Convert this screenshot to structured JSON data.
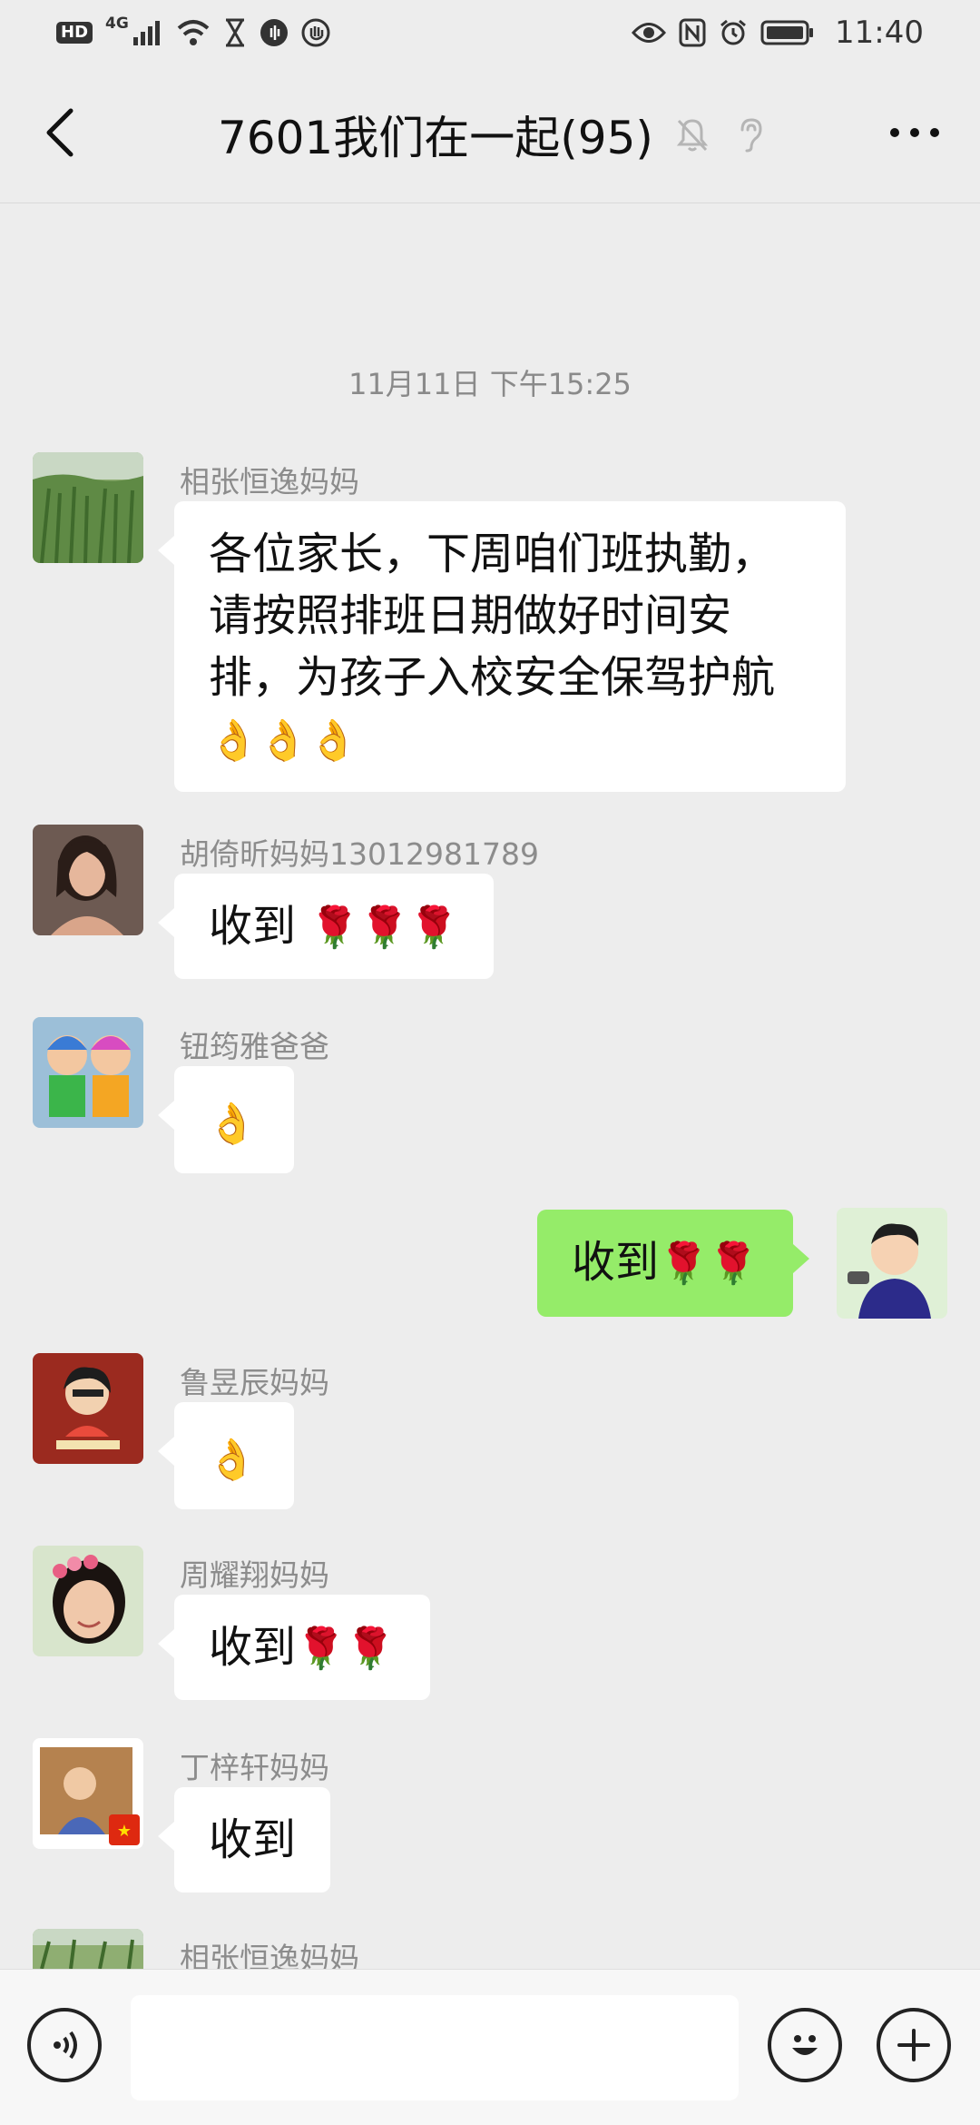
{
  "status_bar": {
    "hd": "HD",
    "network": "4G",
    "time": "11:40",
    "icons": [
      "signal-icon",
      "wifi-icon",
      "hourglass-icon",
      "sound-icon",
      "hand-icon",
      "eye-icon",
      "nfc-icon",
      "alarm-icon",
      "battery-icon"
    ]
  },
  "header": {
    "title": "7601我们在一起(95)",
    "icons": [
      "back-icon",
      "mute-bell-icon",
      "earpiece-icon",
      "more-icon"
    ]
  },
  "chat": {
    "timestamp": "11月11日 下午15:25",
    "messages": [
      {
        "sender": "相张恒逸妈妈",
        "text": "各位家长，下周咱们班执勤，请按照排班日期做好时间安排，为孩子入校安全保驾护航",
        "emoji": "👌👌👌"
      },
      {
        "sender": "胡倚昕妈妈13012981789",
        "text": "收到",
        "emoji": "🌹🌹🌹"
      },
      {
        "sender": "钮筠雅爸爸",
        "text": "",
        "emoji": "👌"
      },
      {
        "sender": "",
        "text": "收到",
        "emoji": "🌹🌹",
        "mine": true
      },
      {
        "sender": "鲁昱辰妈妈",
        "text": "",
        "emoji": "👌"
      },
      {
        "sender": "周耀翔妈妈",
        "text": "收到",
        "emoji": "🌹🌹"
      },
      {
        "sender": "丁梓轩妈妈",
        "text": "收到",
        "emoji": ""
      },
      {
        "sender": "相张恒逸妈妈",
        "text": "",
        "emoji": ""
      }
    ]
  },
  "input_bar": {
    "value": "",
    "icons": [
      "voice-icon",
      "emoji-icon",
      "plus-icon"
    ]
  },
  "colors": {
    "background": "#ededed",
    "bubble_other": "#ffffff",
    "bubble_mine": "#95ec69"
  }
}
